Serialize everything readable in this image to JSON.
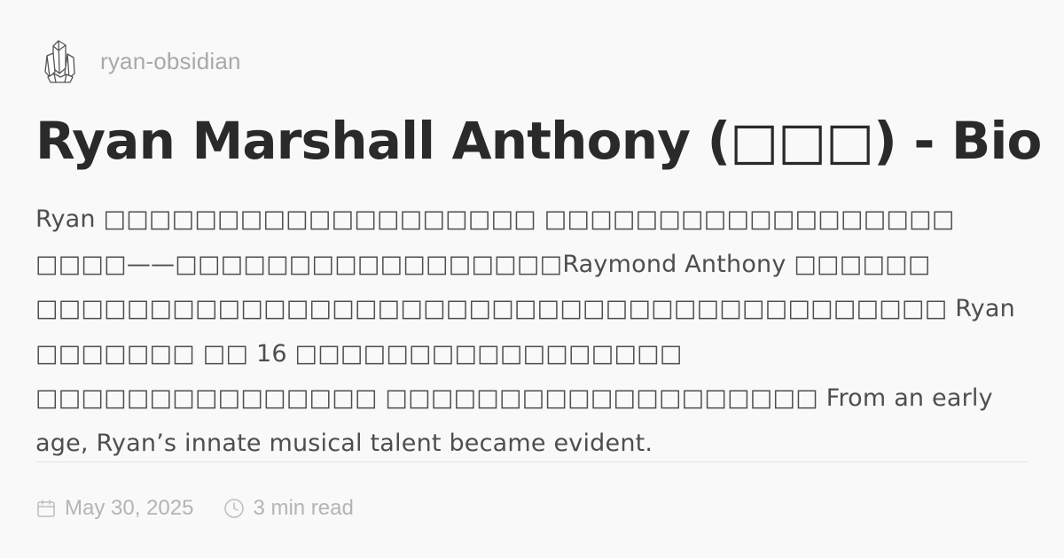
{
  "site": {
    "name": "ryan-obsidian",
    "logo_icon": "crystal-cluster-icon"
  },
  "post": {
    "title": "Ryan Marshall Anthony (□□□) - Bio",
    "excerpt": "Ryan □□□□□□□□□□□□□□□□□□□  □□□□□□□□□□□□□□□□□□  □□□□——□□□□□□□□□□□□□□□□□Raymond Anthony □□□□□□  □□□□□□□□□□□□□□□□□□□□□□□□□□□□□□□□□□□□□□□□  Ryan □□□□□□□  □□ 16 □□□□□□□□□□□□□□□□□  □□□□□□□□□□□□□□□  □□□□□□□□□□□□□□□□□□□ From an early age, Ryan’s innate musical talent became evident.",
    "date": "May 30, 2025",
    "read_time": "3 min read"
  },
  "icons": {
    "date": "calendar-icon",
    "read_time": "clock-icon"
  },
  "colors": {
    "background": "#f9f9f9",
    "title": "#2a2a2a",
    "body_text": "#4e4e4e",
    "muted": "#b4b4b4",
    "divider": "#e4e4e4"
  }
}
